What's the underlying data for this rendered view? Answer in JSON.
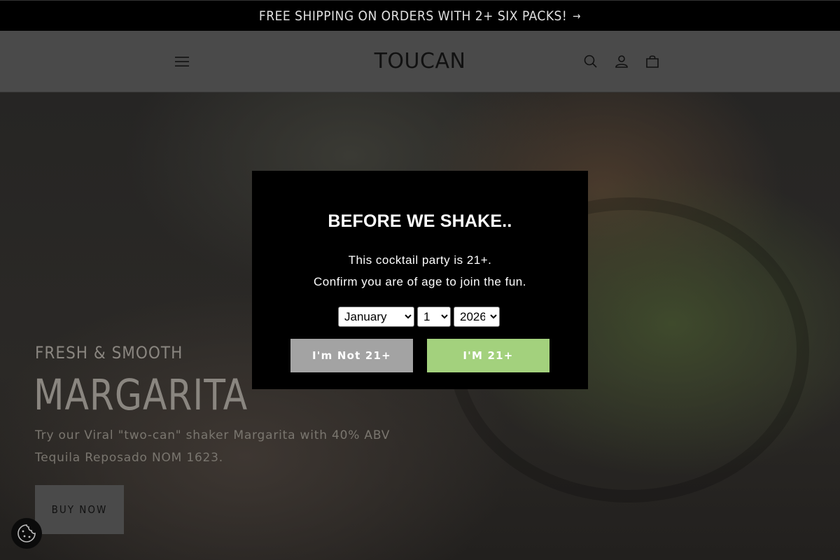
{
  "announcement": {
    "text": "FREE SHIPPING ON ORDERS WITH 2+ SIX PACKS!",
    "arrow": "→"
  },
  "header": {
    "logo": "TOUCAN",
    "icons": [
      "menu-icon",
      "search-icon",
      "account-icon",
      "cart-icon"
    ]
  },
  "hero": {
    "kicker": "FRESH & SMOOTH",
    "title": "MARGARITA",
    "description": "Try our Viral \"two-can\" shaker Margarita with 40% ABV Tequila Reposado NOM 1623.",
    "button": "BUY NOW"
  },
  "age_gate": {
    "title": "BEFORE WE SHAKE..",
    "line1": "This cocktail party is 21+.",
    "line2": "Confirm you are of age to join the fun.",
    "month": "January",
    "day": "1",
    "year": "2026",
    "deny_button": "I'm Not 21+",
    "confirm_button": "I'M 21+"
  },
  "colors": {
    "modal_bg": "#000000",
    "deny_button": "#a3a3a3",
    "confirm_button": "#a3d17d",
    "announcement_bg": "#000000"
  }
}
